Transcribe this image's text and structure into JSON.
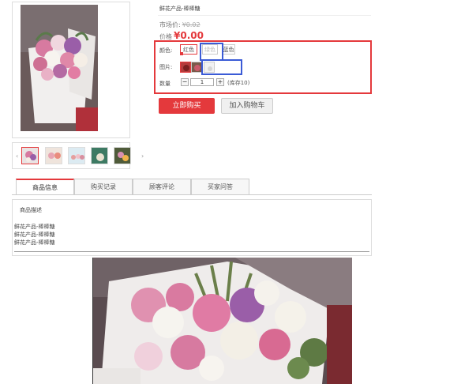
{
  "product": {
    "title": "鲜花产品-棒棒糖",
    "market_label": "市场价:",
    "market_price": "¥0.02",
    "price_label": "价格",
    "price": "¥0.00"
  },
  "options": {
    "color_label": "颜色:",
    "colors": [
      "红色",
      "绿色",
      "蓝色"
    ],
    "image_label": "图片:",
    "qty_label": "数量",
    "qty_minus": "−",
    "qty_plus": "+",
    "qty_value": "1",
    "stock": "(库存10)"
  },
  "actions": {
    "buy_now": "立即购买",
    "add_to_cart": "加入购物车"
  },
  "tabs": [
    "商品信息",
    "购买记录",
    "顾客评论",
    "买家问答"
  ],
  "description": {
    "heading": "商品描述",
    "lines": [
      "鲜花产品-棒棒糖",
      "鲜花产品-棒棒糖",
      "鲜花产品-棒棒糖"
    ]
  },
  "colors_theme": {
    "accent": "#e4393c",
    "highlight_blue": "#3b5bd6"
  },
  "icons": [
    "chevron-left-icon",
    "chevron-right-icon"
  ]
}
